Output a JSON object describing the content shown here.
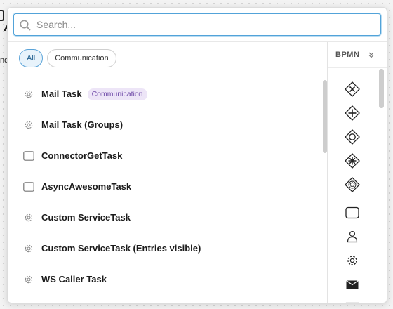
{
  "canvas": {
    "fragment_text": "nd"
  },
  "search": {
    "placeholder": "Search..."
  },
  "filters": [
    {
      "label": "All",
      "active": true
    },
    {
      "label": "Communication",
      "active": false
    }
  ],
  "items": [
    {
      "label": "Mail Task",
      "icon": "gear-icon",
      "badge": "Communication"
    },
    {
      "label": "Mail Task (Groups)",
      "icon": "gear-icon"
    },
    {
      "label": "ConnectorGetTask",
      "icon": "task-box-icon"
    },
    {
      "label": "AsyncAwesomeTask",
      "icon": "task-box-icon"
    },
    {
      "label": "Custom ServiceTask",
      "icon": "gear-icon"
    },
    {
      "label": "Custom ServiceTask (Entries visible)",
      "icon": "gear-icon"
    },
    {
      "label": "WS Caller Task",
      "icon": "gear-icon"
    }
  ],
  "sidebar": {
    "title": "BPMN",
    "shapes": [
      "exclusive-gateway-icon",
      "parallel-gateway-icon",
      "inclusive-gateway-icon",
      "complex-gateway-icon",
      "event-based-gateway-icon",
      "task-icon",
      "user-task-icon",
      "service-task-icon",
      "send-task-icon",
      "receive-task-icon"
    ]
  },
  "colors": {
    "accent": "#52a3d9",
    "badge_bg": "#ede5f7",
    "badge_text": "#6f4aa8"
  }
}
